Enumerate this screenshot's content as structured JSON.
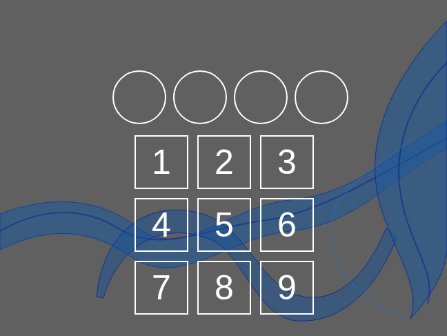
{
  "pin": {
    "dots": [
      {
        "filled": false
      },
      {
        "filled": false
      },
      {
        "filled": false
      },
      {
        "filled": false
      }
    ]
  },
  "keypad": {
    "keys": [
      {
        "label": "1"
      },
      {
        "label": "2"
      },
      {
        "label": "3"
      },
      {
        "label": "4"
      },
      {
        "label": "5"
      },
      {
        "label": "6"
      },
      {
        "label": "7"
      },
      {
        "label": "8"
      },
      {
        "label": "9"
      }
    ]
  }
}
